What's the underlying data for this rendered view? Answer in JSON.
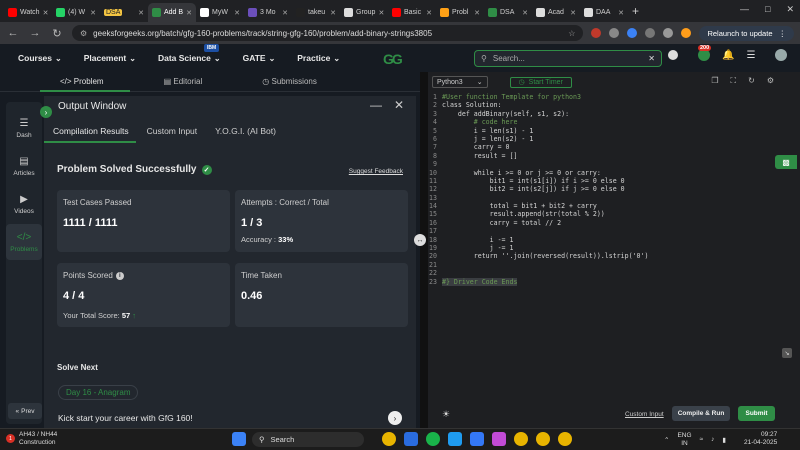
{
  "browser": {
    "tabs": [
      {
        "label": "Watch",
        "color": "#ff0000"
      },
      {
        "label": "(4) W",
        "color": "#25d366"
      },
      {
        "label": "DSA",
        "color": "#f4c542",
        "chip": true
      },
      {
        "label": "Add B",
        "color": "#2f8d46",
        "active": true
      },
      {
        "label": "MyW",
        "color": "#ffffff"
      },
      {
        "label": "3 Mo",
        "color": "#6b4fbb"
      },
      {
        "label": "takeu",
        "color": "#222222"
      },
      {
        "label": "Group",
        "color": "#dddddd"
      },
      {
        "label": "Basic",
        "color": "#ff0000"
      },
      {
        "label": "Probl",
        "color": "#ffa116"
      },
      {
        "label": "DSA",
        "color": "#2f8d46"
      },
      {
        "label": "Acad",
        "color": "#dddddd"
      },
      {
        "label": "DAA",
        "color": "#dddddd"
      }
    ],
    "new_tab": "+",
    "url": "geeksforgeeks.org/batch/gfg-160-problems/track/string-gfg-160/problem/add-binary-strings3805",
    "relaunch": "Relaunch to update"
  },
  "site": {
    "nav": [
      {
        "label": "Courses",
        "name": "nav-courses"
      },
      {
        "label": "Placement",
        "name": "nav-placement"
      },
      {
        "label": "Data Science",
        "name": "nav-data-science"
      },
      {
        "label": "GATE",
        "name": "nav-gate"
      },
      {
        "label": "Practice",
        "name": "nav-practice"
      }
    ],
    "ibm_badge": "IBM",
    "logo": "GG",
    "search_placeholder": "Search...",
    "notification_count": "200"
  },
  "problem_tabs": {
    "problem": "Problem",
    "editorial": "Editorial",
    "submissions": "Submissions"
  },
  "sidebar": {
    "items": [
      {
        "label": "Dash",
        "icon": "dashboard-icon",
        "glyph": "☰"
      },
      {
        "label": "Articles",
        "icon": "articles-icon",
        "glyph": "▤"
      },
      {
        "label": "Videos",
        "icon": "videos-icon",
        "glyph": "▶"
      },
      {
        "label": "Problems",
        "icon": "problems-icon",
        "glyph": "</>",
        "active": true
      }
    ],
    "prev": "Prev"
  },
  "output": {
    "title": "Output Window",
    "tabs": [
      "Compilation Results",
      "Custom Input",
      "Y.O.G.I. (AI Bot)"
    ],
    "status": "Problem Solved Successfully",
    "suggest": "Suggest Feedback",
    "test_cases_label": "Test Cases Passed",
    "test_cases_value": "1111 / 1111",
    "attempts_label": "Attempts : Correct / Total",
    "attempts_value": "1 / 3",
    "accuracy_label": "Accuracy :",
    "accuracy_value": "33%",
    "points_label": "Points Scored",
    "points_value": "4 / 4",
    "total_score_label": "Your Total Score:",
    "total_score_value": "57",
    "time_label": "Time Taken",
    "time_value": "0.46",
    "solve_next": "Solve Next",
    "next_problem": "Day 16 - Anagram",
    "kickstart": "Kick start your career with GfG 160!"
  },
  "editor": {
    "language": "Python3",
    "timer": "Start Timer",
    "lines": [
      {
        "n": "1",
        "t": "#User function Template for python3",
        "c": "#6a9955"
      },
      {
        "n": "2",
        "t": "class Solution:",
        "c": "#d4d4d4"
      },
      {
        "n": "3",
        "t": "    def addBinary(self, s1, s2):",
        "c": "#d4d4d4"
      },
      {
        "n": "4",
        "t": "        # code here",
        "c": "#6a9955"
      },
      {
        "n": "5",
        "t": "        i = len(s1) - 1",
        "c": "#d4d4d4"
      },
      {
        "n": "6",
        "t": "        j = len(s2) - 1",
        "c": "#d4d4d4"
      },
      {
        "n": "7",
        "t": "        carry = 0",
        "c": "#d4d4d4"
      },
      {
        "n": "8",
        "t": "        result = []",
        "c": "#d4d4d4"
      },
      {
        "n": "9",
        "t": "",
        "c": "#d4d4d4"
      },
      {
        "n": "10",
        "t": "        while i >= 0 or j >= 0 or carry:",
        "c": "#d4d4d4"
      },
      {
        "n": "11",
        "t": "            bit1 = int(s1[i]) if i >= 0 else 0",
        "c": "#d4d4d4"
      },
      {
        "n": "12",
        "t": "            bit2 = int(s2[j]) if j >= 0 else 0",
        "c": "#d4d4d4"
      },
      {
        "n": "13",
        "t": "",
        "c": "#d4d4d4"
      },
      {
        "n": "14",
        "t": "            total = bit1 + bit2 + carry",
        "c": "#d4d4d4"
      },
      {
        "n": "15",
        "t": "            result.append(str(total % 2))",
        "c": "#d4d4d4"
      },
      {
        "n": "16",
        "t": "            carry = total // 2",
        "c": "#d4d4d4"
      },
      {
        "n": "17",
        "t": "",
        "c": "#d4d4d4"
      },
      {
        "n": "18",
        "t": "            i -= 1",
        "c": "#d4d4d4"
      },
      {
        "n": "19",
        "t": "            j -= 1",
        "c": "#d4d4d4"
      },
      {
        "n": "20",
        "t": "        return ''.join(reversed(result)).lstrip('0')",
        "c": "#d4d4d4"
      },
      {
        "n": "21",
        "t": "",
        "c": "#d4d4d4"
      },
      {
        "n": "22",
        "t": "",
        "c": "#d4d4d4"
      },
      {
        "n": "23",
        "t": "#} Driver Code Ends",
        "c": "#6a9955",
        "hl": true
      }
    ],
    "custom_input": "Custom Input",
    "compile": "Compile & Run",
    "submit": "Submit"
  },
  "taskbar": {
    "weather_title": "AH43 / NH44",
    "weather_sub": "Construction",
    "alert_count": "1",
    "search": "Search",
    "lang1": "ENG",
    "lang2": "IN",
    "time": "09:27",
    "date": "21-04-2025"
  },
  "colors": {
    "accent": "#2f8d46",
    "panel": "#22272e",
    "card": "#2d333b"
  }
}
